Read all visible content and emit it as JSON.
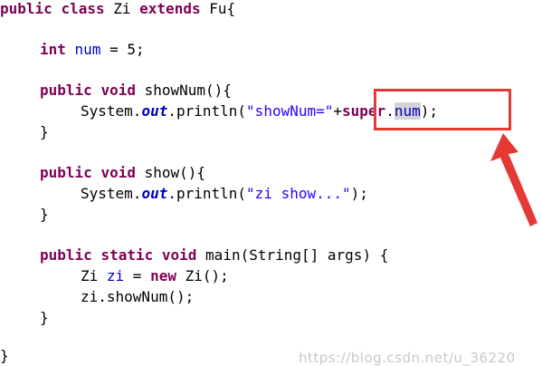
{
  "code": {
    "class_decl": {
      "kw1": "public",
      "kw2": "class",
      "name": "Zi",
      "kw3": "extends",
      "parent": "Fu{"
    },
    "field_decl": {
      "type": "int",
      "name": "num",
      "rest": " = 5;"
    },
    "show_num_method": {
      "kw1": "public",
      "kw2": "void",
      "sig": "showNum(){",
      "body_pre": "System.",
      "body_out": "out",
      "body_call": ".println(",
      "body_str": "\"showNum=\"",
      "body_plus": "+",
      "body_super": "super",
      "body_dot": ".",
      "body_num": "num",
      "body_end": ");",
      "close": "}"
    },
    "show_method": {
      "kw1": "public",
      "kw2": "void",
      "sig": "show(){",
      "body_pre": "System.",
      "body_out": "out",
      "body_call": ".println(",
      "body_str": "\"zi show...\"",
      "body_end": ");",
      "close": "}"
    },
    "main_method": {
      "kw1": "public",
      "kw2": "static",
      "kw3": "void",
      "sig": "main(String[] args) {",
      "line1_type": "Zi ",
      "line1_var": "zi",
      "line1_eq": " = ",
      "line1_new": "new",
      "line1_ctor": " Zi();",
      "line2": "zi.showNum();",
      "close": "}"
    },
    "class_close": "}"
  },
  "annotation": {
    "box_color": "#e53935",
    "arrow_color": "#e53935"
  },
  "watermark": "https://blog.csdn.net/u_36220"
}
